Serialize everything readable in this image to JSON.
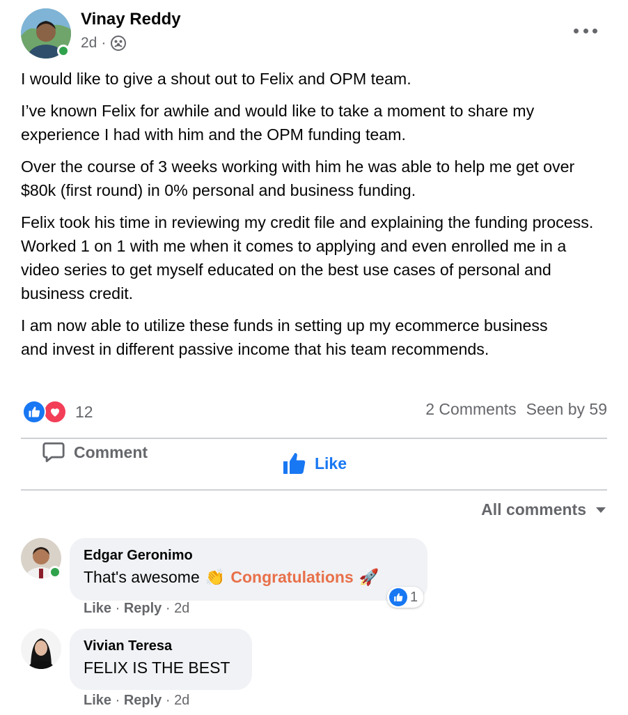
{
  "post": {
    "author": "Vinay Reddy",
    "time": "2d",
    "separator": "·",
    "audience_icon": "group-icon",
    "paragraphs": [
      "I would like to give a shout out to Felix and OPM team.",
      "I’ve known Felix for awhile and would like to take a moment to share my experience I had with him and the OPM funding team.",
      "Over the course of 3 weeks working with him he was able to help me get over $80k (first round)  in 0%  personal and business funding.",
      "Felix took his time in reviewing my credit file and explaining the funding process. Worked 1 on 1 with me when it comes to applying and even enrolled me in a video series to get myself educated on the best use cases of personal and business credit.",
      "I am now able to utilize these funds in setting up my ecommerce business and invest in different passive income that his team recommends."
    ]
  },
  "stats": {
    "reaction_count": "12",
    "comments": "2 Comments",
    "seen_by": "Seen by 59"
  },
  "actions": {
    "like": "Like",
    "comment": "Comment"
  },
  "comments_filter": "All comments",
  "comments": [
    {
      "name": "Edgar Geronimo",
      "text": "That's awesome",
      "emoji_1": "👏",
      "highlight": "Congratulations",
      "emoji_2": "🚀",
      "like": "Like",
      "reply": "Reply",
      "time": "2d",
      "reaction_count": "1"
    },
    {
      "name": "Vivian Teresa",
      "text": "FELIX IS THE BEST",
      "like": "Like",
      "reply": "Reply",
      "time": "2d"
    }
  ],
  "colors": {
    "accent": "#1877f2",
    "online": "#31a24c",
    "love": "#f33e58",
    "congrats": "#e8704a",
    "muted": "#65676b"
  }
}
